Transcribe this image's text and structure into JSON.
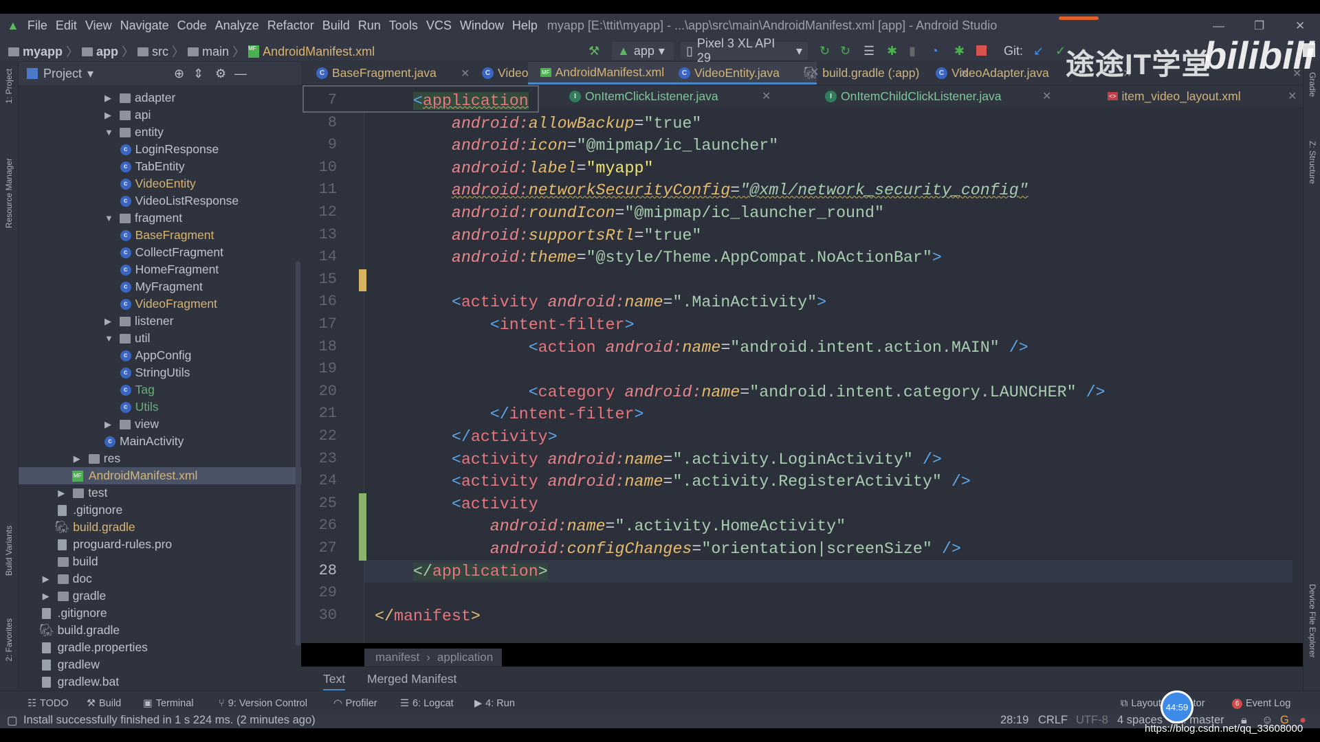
{
  "window": {
    "title": "myapp [E:\\ttit\\myapp] - ...\\app\\src\\main\\AndroidManifest.xml [app] - Android Studio",
    "minimize": "—",
    "restore": "❐",
    "close": "✕"
  },
  "menu": [
    "File",
    "Edit",
    "View",
    "Navigate",
    "Code",
    "Analyze",
    "Refactor",
    "Build",
    "Run",
    "Tools",
    "VCS",
    "Window",
    "Help"
  ],
  "breadcrumb": [
    "myapp",
    "app",
    "src",
    "main",
    "AndroidManifest.xml"
  ],
  "toolbar": {
    "run_config": "app",
    "device": "Pixel 3 XL API 29",
    "git_label": "Git:"
  },
  "project_panel": {
    "title": "Project",
    "items": [
      {
        "label": "adapter",
        "type": "folder",
        "arrow": "right",
        "depth": 5
      },
      {
        "label": "api",
        "type": "folder",
        "arrow": "right",
        "depth": 5
      },
      {
        "label": "entity",
        "type": "folder",
        "arrow": "down",
        "depth": 5
      },
      {
        "label": "LoginResponse",
        "type": "class",
        "depth": 6
      },
      {
        "label": "TabEntity",
        "type": "class",
        "depth": 6
      },
      {
        "label": "VideoEntity",
        "type": "class",
        "depth": 6,
        "status": "modified"
      },
      {
        "label": "VideoListResponse",
        "type": "class",
        "depth": 6
      },
      {
        "label": "fragment",
        "type": "folder",
        "arrow": "down",
        "depth": 5
      },
      {
        "label": "BaseFragment",
        "type": "class",
        "depth": 6,
        "status": "modified"
      },
      {
        "label": "CollectFragment",
        "type": "class",
        "depth": 6
      },
      {
        "label": "HomeFragment",
        "type": "class",
        "depth": 6
      },
      {
        "label": "MyFragment",
        "type": "class",
        "depth": 6
      },
      {
        "label": "VideoFragment",
        "type": "class",
        "depth": 6,
        "status": "modified"
      },
      {
        "label": "listener",
        "type": "folder",
        "arrow": "right",
        "depth": 5
      },
      {
        "label": "util",
        "type": "folder",
        "arrow": "down",
        "depth": 5
      },
      {
        "label": "AppConfig",
        "type": "class",
        "depth": 6
      },
      {
        "label": "StringUtils",
        "type": "class",
        "depth": 6
      },
      {
        "label": "Tag",
        "type": "class",
        "depth": 6,
        "status": "added"
      },
      {
        "label": "Utils",
        "type": "class",
        "depth": 6,
        "status": "added"
      },
      {
        "label": "view",
        "type": "folder",
        "arrow": "right",
        "depth": 5
      },
      {
        "label": "MainActivity",
        "type": "class",
        "depth": 5
      },
      {
        "label": "res",
        "type": "folder",
        "arrow": "right",
        "depth": 3
      },
      {
        "label": "AndroidManifest.xml",
        "type": "manifest",
        "depth": 3,
        "status": "modified",
        "selected": true
      },
      {
        "label": "test",
        "type": "folder",
        "arrow": "right",
        "depth": 2
      },
      {
        "label": ".gitignore",
        "type": "file",
        "depth": 2
      },
      {
        "label": "build.gradle",
        "type": "gradle",
        "depth": 2,
        "status": "modified"
      },
      {
        "label": "proguard-rules.pro",
        "type": "file",
        "depth": 2
      },
      {
        "label": "build",
        "type": "folder",
        "depth": 1
      },
      {
        "label": "doc",
        "type": "folder",
        "arrow": "right",
        "depth": 1
      },
      {
        "label": "gradle",
        "type": "folder",
        "arrow": "right",
        "depth": 1
      },
      {
        "label": ".gitignore",
        "type": "file",
        "depth": 1
      },
      {
        "label": "build.gradle",
        "type": "gradle",
        "depth": 1
      },
      {
        "label": "gradle.properties",
        "type": "file",
        "depth": 1
      },
      {
        "label": "gradlew",
        "type": "file",
        "depth": 1
      },
      {
        "label": "gradlew.bat",
        "type": "file",
        "depth": 1
      }
    ]
  },
  "tabs_row1": [
    {
      "label": "BaseFragment.java",
      "icon": "class"
    },
    {
      "label": "VideoFragment.java",
      "icon": "class"
    },
    {
      "label": "AndroidManifest.xml",
      "icon": "manifest",
      "active": true
    },
    {
      "label": "VideoEntity.java",
      "icon": "class"
    },
    {
      "label": "build.gradle (:app)",
      "icon": "gradle"
    },
    {
      "label": "VideoAdapter.java",
      "icon": "class"
    }
  ],
  "tabs_row2": [
    {
      "label": "OnItemClickListener.java",
      "icon": "interface"
    },
    {
      "label": "OnItemChildClickListener.java",
      "icon": "interface"
    },
    {
      "label": "item_video_layout.xml",
      "icon": "layout"
    }
  ],
  "code": {
    "current_line": 28,
    "lines": [
      {
        "n": 7,
        "tokens": [
          [
            "w",
            "    "
          ],
          [
            "b",
            "<"
          ],
          [
            "t sq",
            "application"
          ]
        ]
      },
      {
        "n": 8,
        "tokens": [
          [
            "w",
            "        "
          ],
          [
            "ap",
            "android:"
          ],
          [
            "an",
            "allowBackup"
          ],
          [
            "eq",
            "="
          ],
          [
            "s",
            "\"true\""
          ]
        ]
      },
      {
        "n": 9,
        "tokens": [
          [
            "w",
            "        "
          ],
          [
            "ap",
            "android:"
          ],
          [
            "an",
            "icon"
          ],
          [
            "eq",
            "="
          ],
          [
            "s",
            "\"@mipmap/ic_launcher\""
          ]
        ]
      },
      {
        "n": 10,
        "tokens": [
          [
            "w",
            "        "
          ],
          [
            "ap",
            "android:"
          ],
          [
            "an",
            "label"
          ],
          [
            "eq",
            "="
          ],
          [
            "sy",
            "\"myapp\""
          ]
        ]
      },
      {
        "n": 11,
        "tokens": [
          [
            "w",
            "        "
          ],
          [
            "ap sq",
            "android:"
          ],
          [
            "an sq",
            "networkSecurityConfig"
          ],
          [
            "eq sq",
            "="
          ],
          [
            "s si sq",
            "\"@xml/network_security_config\""
          ]
        ]
      },
      {
        "n": 12,
        "tokens": [
          [
            "w",
            "        "
          ],
          [
            "ap",
            "android:"
          ],
          [
            "an",
            "roundIcon"
          ],
          [
            "eq",
            "="
          ],
          [
            "s",
            "\"@mipmap/ic_launcher_round\""
          ]
        ]
      },
      {
        "n": 13,
        "tokens": [
          [
            "w",
            "        "
          ],
          [
            "ap",
            "android:"
          ],
          [
            "an",
            "supportsRtl"
          ],
          [
            "eq",
            "="
          ],
          [
            "s",
            "\"true\""
          ]
        ]
      },
      {
        "n": 14,
        "tokens": [
          [
            "w",
            "        "
          ],
          [
            "ap",
            "android:"
          ],
          [
            "an",
            "theme"
          ],
          [
            "eq",
            "="
          ],
          [
            "s",
            "\"@style/Theme.AppCompat.NoActionBar\""
          ],
          [
            "b",
            ">"
          ]
        ]
      },
      {
        "n": 15,
        "tokens": []
      },
      {
        "n": 16,
        "tokens": [
          [
            "w",
            "        "
          ],
          [
            "b",
            "<"
          ],
          [
            "t",
            "activity "
          ],
          [
            "ap",
            "android:"
          ],
          [
            "an",
            "name"
          ],
          [
            "eq",
            "="
          ],
          [
            "s",
            "\".MainActivity\""
          ],
          [
            "b",
            ">"
          ]
        ]
      },
      {
        "n": 17,
        "tokens": [
          [
            "w",
            "            "
          ],
          [
            "b",
            "<"
          ],
          [
            "t",
            "intent-filter"
          ],
          [
            "b",
            ">"
          ]
        ]
      },
      {
        "n": 18,
        "tokens": [
          [
            "w",
            "                "
          ],
          [
            "b",
            "<"
          ],
          [
            "t",
            "action "
          ],
          [
            "ap",
            "android:"
          ],
          [
            "an",
            "name"
          ],
          [
            "eq",
            "="
          ],
          [
            "s",
            "\"android.intent.action.MAIN\" "
          ],
          [
            "b",
            "/>"
          ]
        ]
      },
      {
        "n": 19,
        "tokens": []
      },
      {
        "n": 20,
        "tokens": [
          [
            "w",
            "                "
          ],
          [
            "b",
            "<"
          ],
          [
            "t",
            "category "
          ],
          [
            "ap",
            "android:"
          ],
          [
            "an",
            "name"
          ],
          [
            "eq",
            "="
          ],
          [
            "s",
            "\"android.intent.category.LAUNCHER\" "
          ],
          [
            "b",
            "/>"
          ]
        ]
      },
      {
        "n": 21,
        "tokens": [
          [
            "w",
            "            "
          ],
          [
            "b",
            "</"
          ],
          [
            "t",
            "intent-filter"
          ],
          [
            "b",
            ">"
          ]
        ]
      },
      {
        "n": 22,
        "tokens": [
          [
            "w",
            "        "
          ],
          [
            "b",
            "</"
          ],
          [
            "t",
            "activity"
          ],
          [
            "b",
            ">"
          ]
        ]
      },
      {
        "n": 23,
        "tokens": [
          [
            "w",
            "        "
          ],
          [
            "b",
            "<"
          ],
          [
            "t",
            "activity "
          ],
          [
            "ap",
            "android:"
          ],
          [
            "an",
            "name"
          ],
          [
            "eq",
            "="
          ],
          [
            "s",
            "\".activity.LoginActivity\" "
          ],
          [
            "b",
            "/>"
          ]
        ]
      },
      {
        "n": 24,
        "tokens": [
          [
            "w",
            "        "
          ],
          [
            "b",
            "<"
          ],
          [
            "t",
            "activity "
          ],
          [
            "ap",
            "android:"
          ],
          [
            "an",
            "name"
          ],
          [
            "eq",
            "="
          ],
          [
            "s",
            "\".activity.RegisterActivity\" "
          ],
          [
            "b",
            "/>"
          ]
        ]
      },
      {
        "n": 25,
        "tokens": [
          [
            "w",
            "        "
          ],
          [
            "b",
            "<"
          ],
          [
            "t",
            "activity"
          ]
        ]
      },
      {
        "n": 26,
        "tokens": [
          [
            "w",
            "            "
          ],
          [
            "ap",
            "android:"
          ],
          [
            "an",
            "name"
          ],
          [
            "eq",
            "="
          ],
          [
            "s",
            "\".activity.HomeActivity\""
          ]
        ]
      },
      {
        "n": 27,
        "tokens": [
          [
            "w",
            "            "
          ],
          [
            "ap",
            "android:"
          ],
          [
            "an",
            "configChanges"
          ],
          [
            "eq",
            "="
          ],
          [
            "s",
            "\"orientation|screenSize\" "
          ],
          [
            "b",
            "/>"
          ]
        ]
      },
      {
        "n": 28,
        "tokens": [
          [
            "w",
            "    "
          ],
          [
            "s",
            "</"
          ],
          [
            "t",
            "application"
          ],
          [
            "s",
            ">"
          ]
        ]
      },
      {
        "n": 29,
        "tokens": []
      },
      {
        "n": 30,
        "tokens": [
          [
            "mb",
            "</"
          ],
          [
            "t",
            "manifest"
          ],
          [
            "mb",
            ">"
          ]
        ]
      }
    ]
  },
  "editor_breadcrumb": [
    "manifest",
    "application"
  ],
  "editor_bottom_tabs": {
    "text": "Text",
    "merged": "Merged Manifest"
  },
  "tool_windows": {
    "left": [
      "TODO",
      "Build",
      "Terminal",
      "9: Version Control",
      "Profiler",
      "6: Logcat",
      "4: Run"
    ],
    "layout_inspector": "Layout Inspector",
    "event_log": "Event Log",
    "event_count": "6"
  },
  "side_strips": {
    "left": [
      "1: Project",
      "Resource Manager",
      "Build Variants",
      "2: Favorites"
    ],
    "right": [
      "Gradle",
      "Z: Structure",
      "Device File Explorer"
    ]
  },
  "status": {
    "message": "Install successfully finished in 1 s 224 ms. (2 minutes ago)",
    "position": "28:19",
    "line_sep": "CRLF",
    "encoding": "UTF-8",
    "indent": "4 spaces",
    "git": "Git: master"
  },
  "overlay": {
    "watermark_cn": "途途IT学堂",
    "watermark_logo": "bilibili",
    "timer": "44:59",
    "url": "https://blog.csdn.net/qq_33608000"
  }
}
